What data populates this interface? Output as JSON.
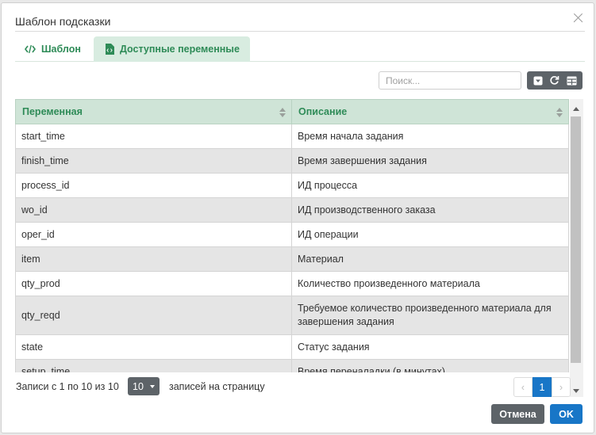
{
  "dialog": {
    "title": "Шаблон подсказки"
  },
  "tabs": [
    {
      "label": "Шаблон",
      "icon": "code-icon"
    },
    {
      "label": "Доступные переменные",
      "icon": "document-code-icon"
    }
  ],
  "search": {
    "placeholder": "Поиск..."
  },
  "toolbar": {
    "icons": [
      "dropdown-icon",
      "refresh-icon",
      "columns-icon"
    ]
  },
  "table": {
    "columns": [
      "Переменная",
      "Описание"
    ],
    "rows": [
      {
        "name": "start_time",
        "description": "Время начала задания"
      },
      {
        "name": "finish_time",
        "description": "Время завершения задания"
      },
      {
        "name": "process_id",
        "description": "ИД процесса"
      },
      {
        "name": "wo_id",
        "description": "ИД производственного заказа"
      },
      {
        "name": "oper_id",
        "description": "ИД операции"
      },
      {
        "name": "item",
        "description": "Материал"
      },
      {
        "name": "qty_prod",
        "description": "Количество произведенного материала"
      },
      {
        "name": "qty_reqd",
        "description": "Требуемое количество произведенного материала для завершения задания"
      },
      {
        "name": "state",
        "description": "Статус задания"
      },
      {
        "name": "setup_time",
        "description": "Время переналадки (в минутах)"
      }
    ]
  },
  "footer": {
    "info": "Записи с 1 по 10 из 10",
    "per_page_value": "10",
    "per_page_label": "записей на страницу",
    "current_page": "1",
    "prev": "‹",
    "next": "›"
  },
  "buttons": {
    "cancel": "Отмена",
    "ok": "OK"
  },
  "colors": {
    "accent": "#2e8b57",
    "header_bg": "#cfe4d7",
    "primary": "#1876c7",
    "dark_button": "#5d6368"
  }
}
